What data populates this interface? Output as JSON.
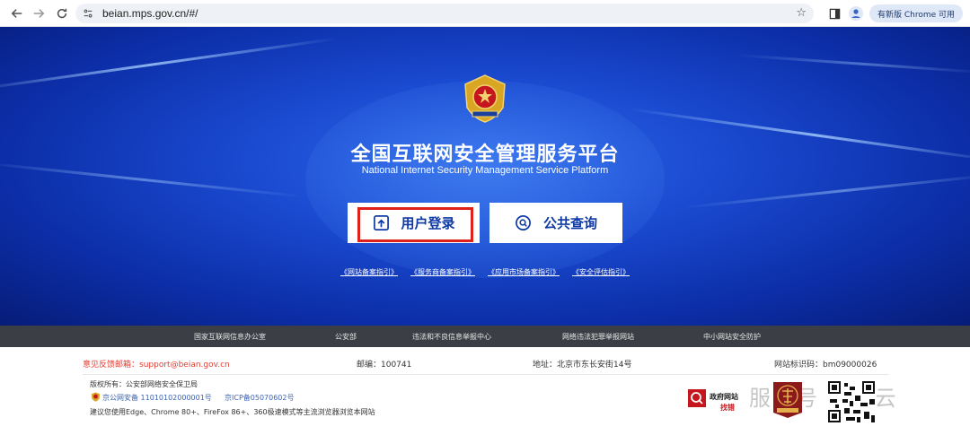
{
  "browser": {
    "url": "beian.mps.gov.cn/#/",
    "update_label": "有新版 Chrome 可用"
  },
  "hero": {
    "title_zh": "全国互联网安全管理服务平台",
    "title_en": "National Internet Security Management Service Platform",
    "login_label": "用户登录",
    "query_label": "公共查询",
    "guides": [
      "《网站备案指引》",
      "《服务商备案指引》",
      "《应用市场备案指引》",
      "《安全评估指引》"
    ]
  },
  "footer_nav": [
    "国家互联网信息办公室",
    "公安部",
    "违法和不良信息举报中心",
    "网络违法犯罪举报网站",
    "中小网站安全防护"
  ],
  "footer": {
    "feedback_label": "意见反馈邮箱：",
    "feedback_email": "support@beian.gov.cn",
    "postcode": "邮编：100741",
    "address": "地址：北京市东长安街14号",
    "site_id": "网站标识码：bm09000026",
    "copyright": "版权所有：公安部网络安全保卫局",
    "gongan_beian": "京公网安备 11010102000001号",
    "icp": "京ICP备05070602号",
    "browser_note": "建议您使用Edge、Chrome 80+、FireFox 86+、360极速模式等主流浏览器浏览本网站",
    "badge_line1": "政府网站",
    "badge_line2": "找错",
    "watermark": "服务号  数慧云"
  },
  "colors": {
    "hero_blue": "#1a4ad0",
    "highlight_red": "#e0211a",
    "button_text": "#0f3aa5",
    "nav_bar": "#3b3f45"
  }
}
